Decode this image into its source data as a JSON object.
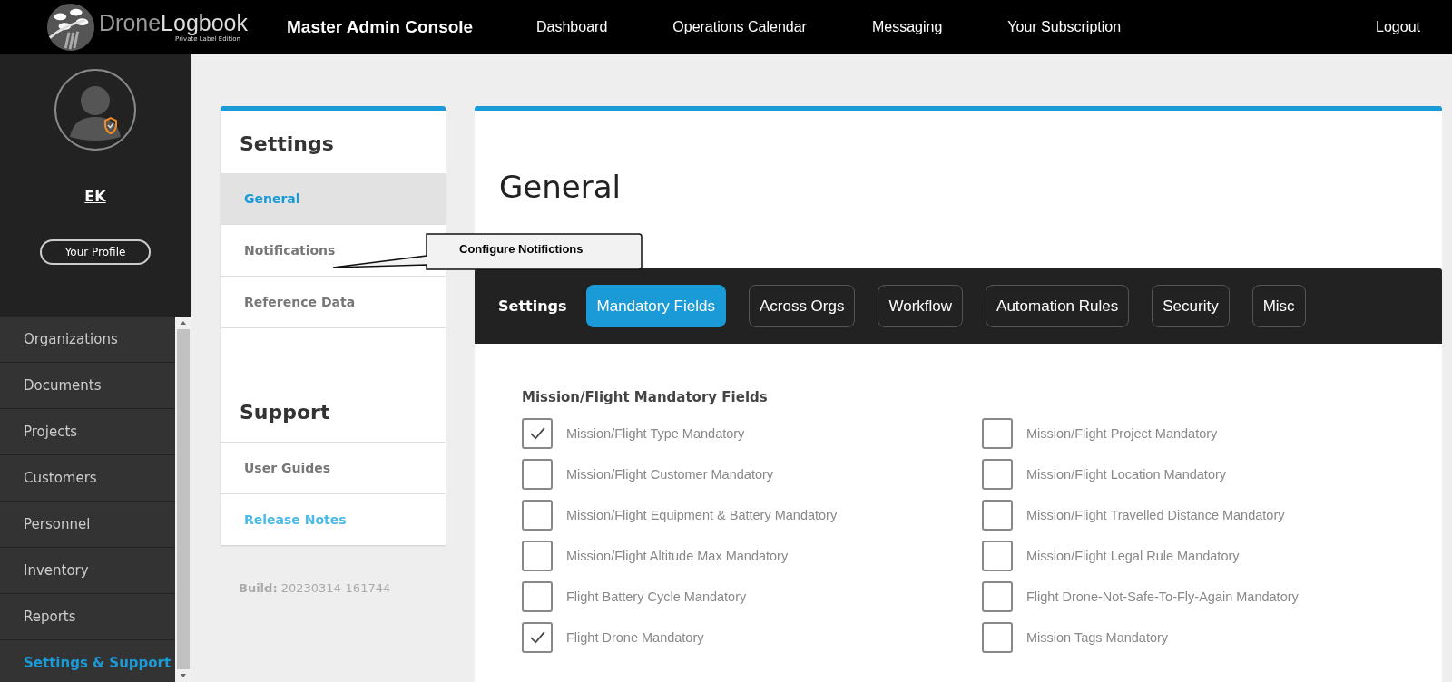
{
  "header": {
    "logo_part_1": "Drone",
    "logo_part_2": "Logbook",
    "logo_tagline": "Private Label Edition",
    "title": "Master Admin Console",
    "nav": [
      {
        "label": "Dashboard"
      },
      {
        "label": "Operations Calendar"
      },
      {
        "label": "Messaging"
      },
      {
        "label": "Your Subscription"
      }
    ],
    "logout": "Logout"
  },
  "sidebar": {
    "user_initials": "EK",
    "profile_button": "Your Profile",
    "items": [
      {
        "label": "Organizations",
        "selected": false
      },
      {
        "label": "Documents",
        "selected": false
      },
      {
        "label": "Projects",
        "selected": false
      },
      {
        "label": "Customers",
        "selected": false
      },
      {
        "label": "Personnel",
        "selected": false
      },
      {
        "label": "Inventory",
        "selected": false
      },
      {
        "label": "Reports",
        "selected": false
      },
      {
        "label": "Settings & Support",
        "selected": true
      }
    ]
  },
  "settings_menu": {
    "title": "Settings",
    "items": [
      {
        "label": "General",
        "selected": true
      },
      {
        "label": "Notifications",
        "selected": false
      },
      {
        "label": "Reference Data",
        "selected": false
      }
    ],
    "support_title": "Support",
    "support_items": [
      {
        "label": "User Guides",
        "kind": "page"
      },
      {
        "label": "Release Notes",
        "kind": "link"
      }
    ],
    "build_label": "Build:",
    "build_value": "20230314-161744"
  },
  "callout": {
    "text": "Configure Notifictions"
  },
  "main": {
    "title": "General",
    "tabs_label": "Settings",
    "tabs": [
      {
        "label": "Mandatory Fields",
        "selected": true
      },
      {
        "label": "Across Orgs",
        "selected": false
      },
      {
        "label": "Workflow",
        "selected": false
      },
      {
        "label": "Automation Rules",
        "selected": false
      },
      {
        "label": "Security",
        "selected": false
      },
      {
        "label": "Misc",
        "selected": false
      }
    ],
    "section_title": "Mission/Flight Mandatory Fields",
    "columns": [
      [
        {
          "label": "Mission/Flight Type Mandatory",
          "checked": true
        },
        {
          "label": "Mission/Flight Customer Mandatory",
          "checked": false
        },
        {
          "label": "Mission/Flight Equipment & Battery Mandatory",
          "checked": false
        },
        {
          "label": "Mission/Flight Altitude Max Mandatory",
          "checked": false
        },
        {
          "label": "Flight Battery Cycle Mandatory",
          "checked": false
        },
        {
          "label": "Flight Drone Mandatory",
          "checked": true
        }
      ],
      [
        {
          "label": "Mission/Flight Project Mandatory",
          "checked": false
        },
        {
          "label": "Mission/Flight Location Mandatory",
          "checked": false
        },
        {
          "label": "Mission/Flight Travelled Distance Mandatory",
          "checked": false
        },
        {
          "label": "Mission/Flight Legal Rule Mandatory",
          "checked": false
        },
        {
          "label": "Flight Drone-Not-Safe-To-Fly-Again Mandatory",
          "checked": false
        },
        {
          "label": "Mission Tags Mandatory",
          "checked": false
        }
      ]
    ]
  }
}
